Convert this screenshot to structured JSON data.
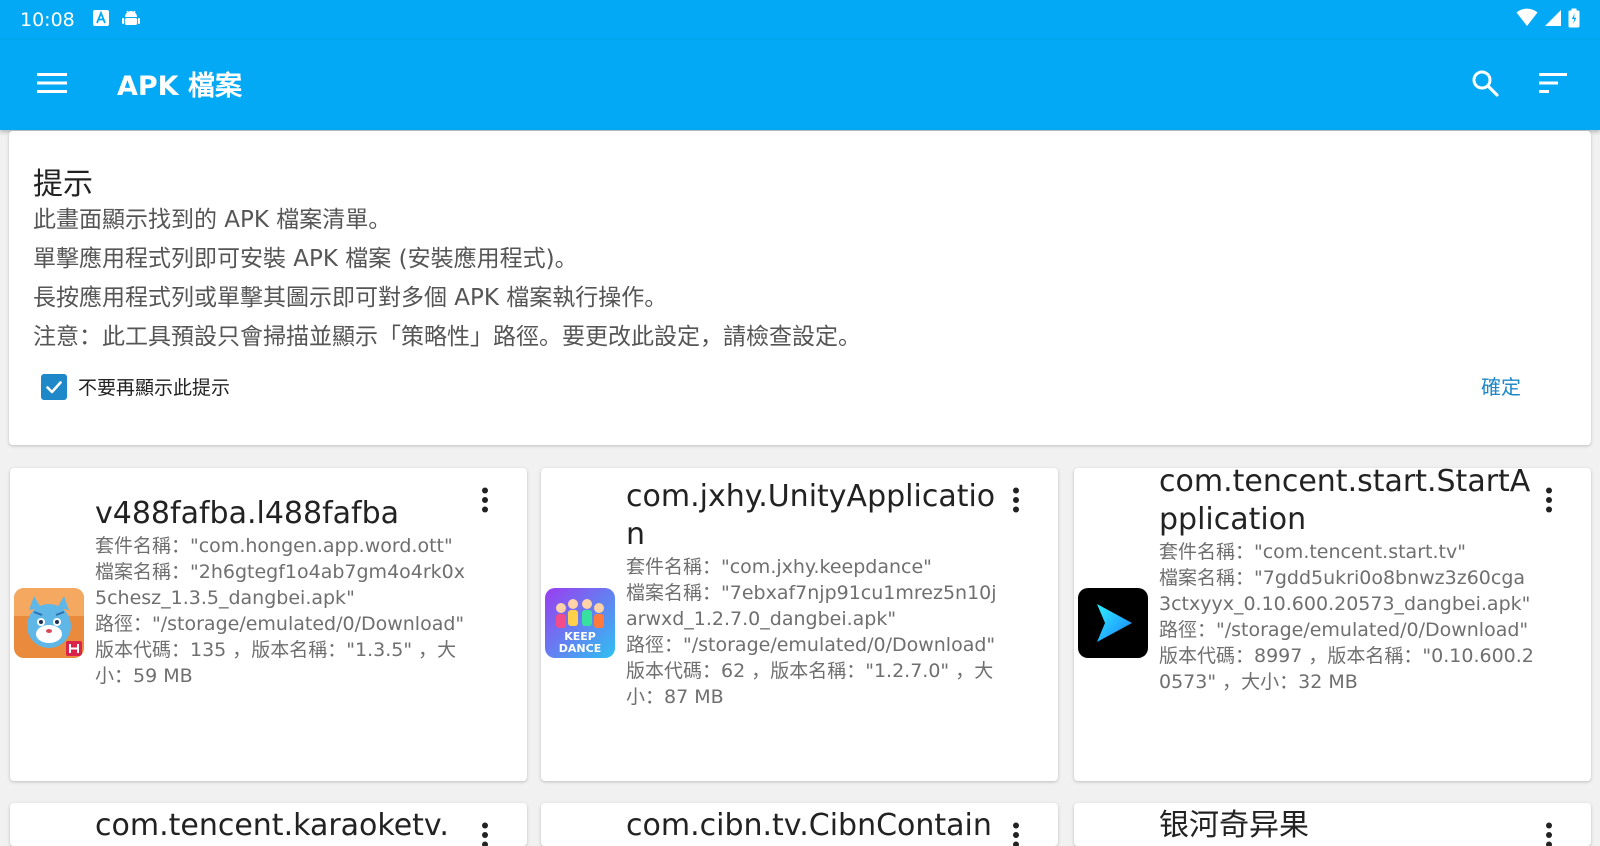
{
  "status_bar": {
    "time": "10:08",
    "icons": [
      "font-notification-icon",
      "android-icon",
      "wifi-icon",
      "signal-icon",
      "battery-icon"
    ]
  },
  "app_bar": {
    "title": "APK 檔案",
    "icons": [
      "menu-icon",
      "search-icon",
      "sort-icon"
    ]
  },
  "tip": {
    "title": "提示",
    "lines": [
      "此畫面顯示找到的 APK 檔案清單。",
      "單擊應用程式列即可安裝 APK 檔案 (安裝應用程式)。",
      "長按應用程式列或單擊其圖示即可對多個 APK 檔案執行操作。",
      "注意：此工具預設只會掃描並顯示「策略性」路徑。要更改此設定，請檢查設定。"
    ],
    "checkbox_label": "不要再顯示此提示",
    "checkbox_checked": true,
    "ok_label": "確定"
  },
  "apps": [
    {
      "title": "v488fafba.l488fafba",
      "package": "套件名稱：\"com.hongen.app.word.ott\"",
      "file": "檔案名稱：\"2h6gtegf1o4ab7gm4o4rk0x5chesz_1.3.5_dangbei.apk\"",
      "path": "路徑：\"/storage/emulated/0/Download\"",
      "version": "版本代碼：135 ，版本名稱：\"1.3.5\" ，大小：59 MB",
      "icon": "tiger-mascot-icon"
    },
    {
      "title": "com.jxhy.UnityApplication",
      "package": "套件名稱：\"com.jxhy.keepdance\"",
      "file": "檔案名稱：\"7ebxaf7njp91cu1mrez5n10jarwxd_1.2.7.0_dangbei.apk\"",
      "path": "路徑：\"/storage/emulated/0/Download\"",
      "version": "版本代碼：62 ，版本名稱：\"1.2.7.0\" ，大小：87 MB",
      "icon": "keep-dance-icon",
      "icon_text": "KEEP DANCE"
    },
    {
      "title": "com.tencent.start.StartApplication",
      "package": "套件名稱：\"com.tencent.start.tv\"",
      "file": "檔案名稱：\"7gdd5ukri0o8bnwz3z60cga3ctxyyx_0.10.600.20573_dangbei.apk\"",
      "path": "路徑：\"/storage/emulated/0/Download\"",
      "version": "版本代碼：8997 ，版本名稱：\"0.10.600.20573\" ，大小：32 MB",
      "icon": "start-play-icon"
    },
    {
      "title": "com.tencent.karaoketv."
    },
    {
      "title": "com.cibn.tv.CibnContain"
    },
    {
      "title": "银河奇异果"
    }
  ],
  "colors": {
    "primary": "#03a9f4",
    "accent": "#1e88c8",
    "text_primary": "#222222",
    "text_secondary": "#6f6f6f"
  }
}
